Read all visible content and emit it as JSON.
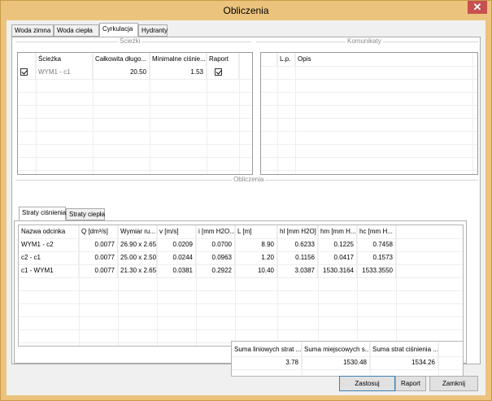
{
  "window": {
    "title": "Obliczenia",
    "close_glyph": "✕"
  },
  "tabs": [
    "Woda zimna",
    "Woda ciepła",
    "Cyrkulacja",
    "Hydranty"
  ],
  "sections": {
    "paths": "Ścieżki",
    "messages": "Komunikaty",
    "calculations": "Obliczenia"
  },
  "paths_table": {
    "headers": [
      "Ścieżka",
      "Całkowita długo...",
      "Minimalne ciśnie...",
      "Raport"
    ],
    "rows": [
      {
        "checked": true,
        "name": "WYM1 - c1",
        "length": "20.50",
        "pressure": "1.53",
        "report": true
      }
    ]
  },
  "messages_table": {
    "headers": [
      "L.p.",
      "Opis"
    ]
  },
  "inner_tabs": [
    "Straty ciśnienia",
    "Straty ciepła"
  ],
  "losses_table": {
    "headers": [
      "Nazwa odcinka",
      "Q [dm³/s]",
      "Wymiar ru...",
      "v [m/s]",
      "i [mm H2O...",
      "L [m]",
      "hl [mm H2O]",
      "hm [mm H...",
      "hc [mm H..."
    ],
    "rows": [
      [
        "WYM1 - c2",
        "0.0077",
        "26.90 x 2.65",
        "0.0209",
        "0.0700",
        "8.90",
        "0.6233",
        "0.1225",
        "0.7458"
      ],
      [
        "c2 - c1",
        "0.0077",
        "25.00 x 2.50",
        "0.0244",
        "0.0963",
        "1.20",
        "0.1156",
        "0.0417",
        "0.1573"
      ],
      [
        "c1 - WYM1",
        "0.0077",
        "21.30 x 2.65",
        "0.0381",
        "0.2922",
        "10.40",
        "3.0387",
        "1530.3164",
        "1533.3550"
      ]
    ]
  },
  "summary_table": {
    "headers": [
      "Suma liniowych strat ...",
      "Suma miejscowych s...",
      "Suma strat ciśnienia ..."
    ],
    "values": [
      "3.78",
      "1530.48",
      "1534.26"
    ]
  },
  "buttons": {
    "apply": "Zastosuj",
    "report": "Raport",
    "close": "Zamknij"
  }
}
